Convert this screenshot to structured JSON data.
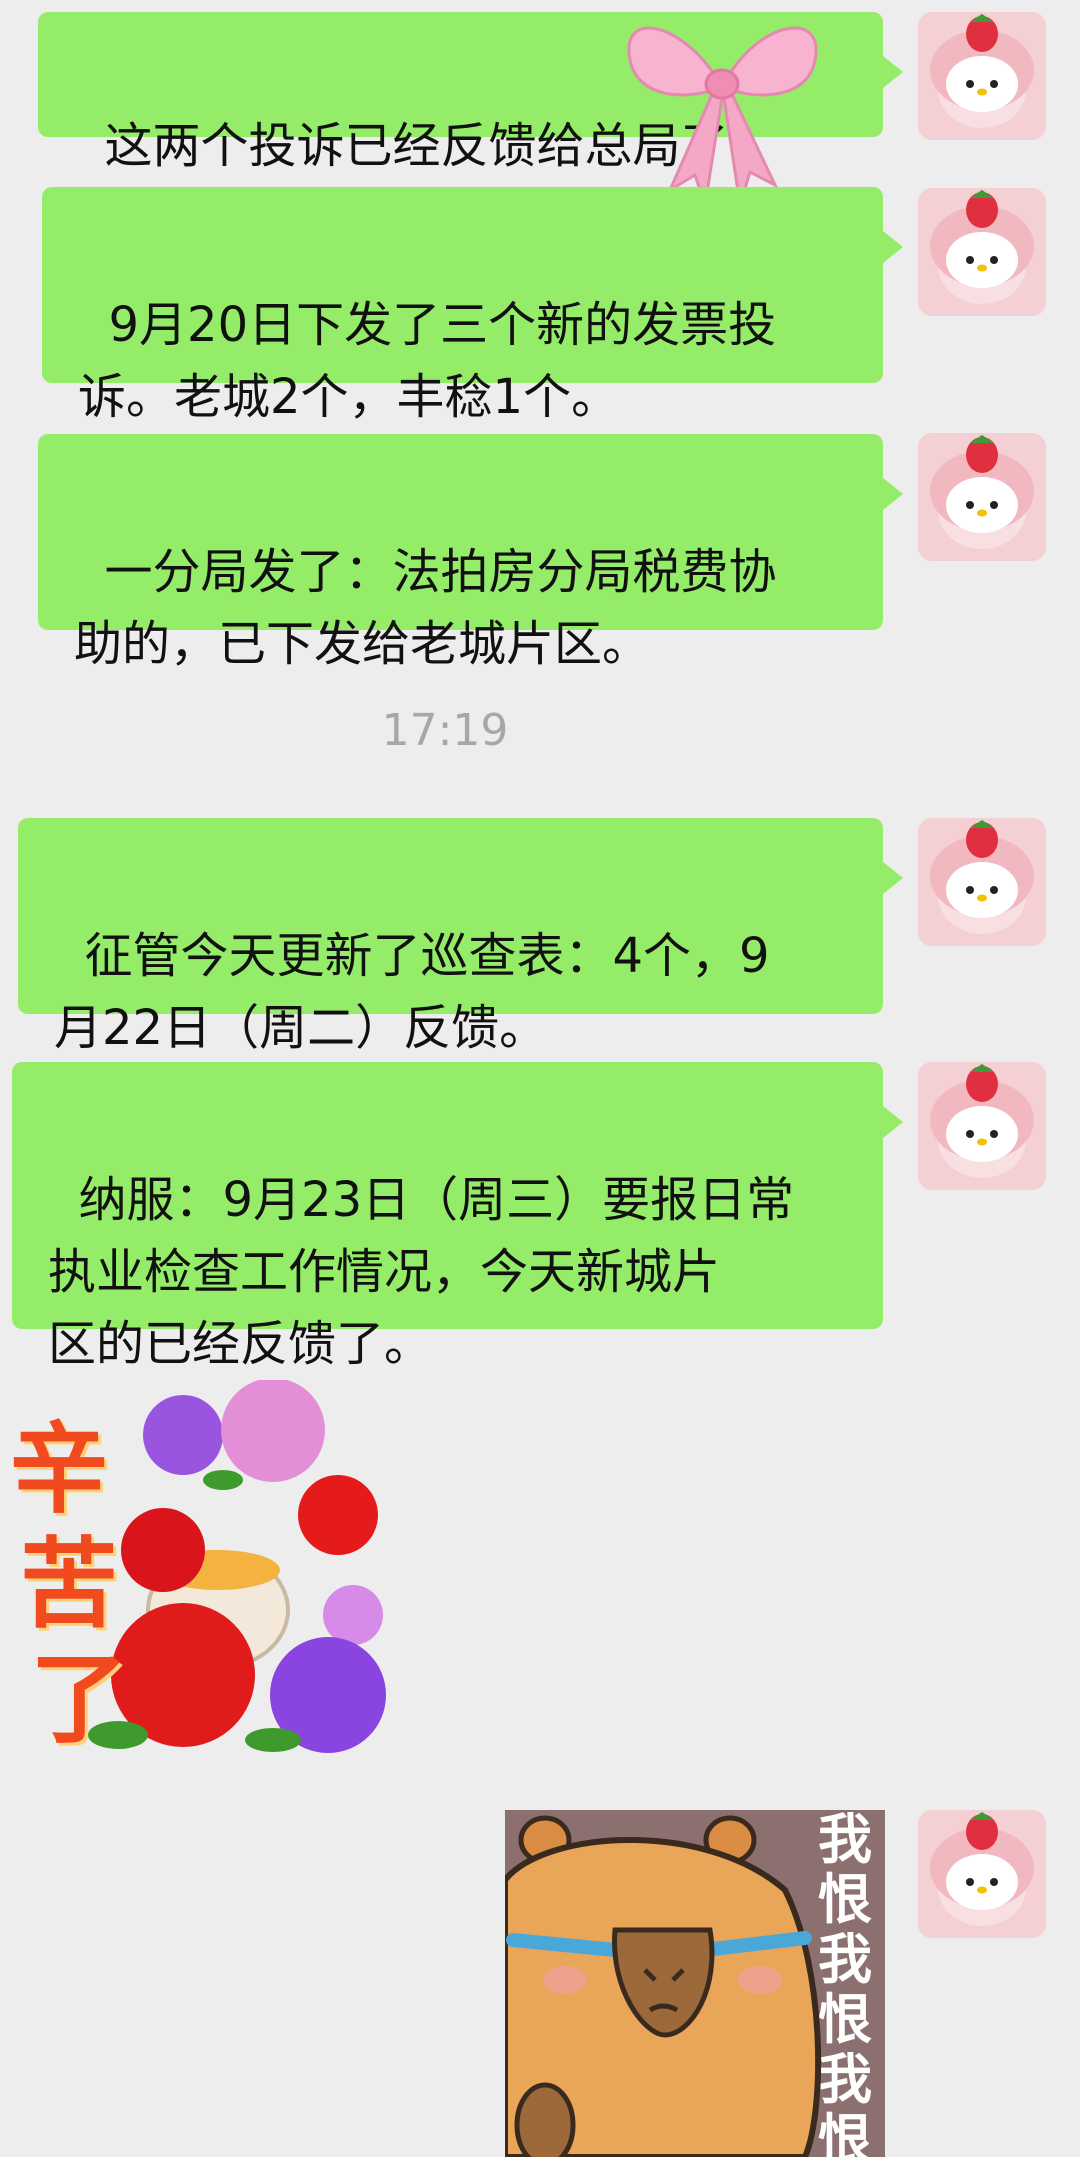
{
  "messages": [
    {
      "text": "这两个投诉已经反馈给总局了"
    },
    {
      "text": "9月20日下发了三个新的发票投\n诉。老城2个，丰稔1个。"
    },
    {
      "text": "一分局发了：法拍房分局税费协\n助的，已下发给老城片区。"
    },
    {
      "text": "征管今天更新了巡查表：4个，9\n月22日（周二）反馈。"
    },
    {
      "text": "纳服：9月23日（周三）要报日常\n执业检查工作情况，今天新城片\n区的已经反馈了。"
    }
  ],
  "timestamp": "17:19",
  "stickers": {
    "roses": {
      "text_lines": [
        "辛",
        "苦",
        "了"
      ]
    },
    "capybara": {
      "text_lines": [
        "我",
        "恨",
        "我",
        "恨",
        "我",
        "恨"
      ]
    }
  },
  "colors": {
    "background": "#ededed",
    "bubble": "#95ec69",
    "timestamp": "#a7a7a7"
  },
  "icons": [
    "hello-kitty-avatar-icon",
    "pink-bow-icon",
    "rose-teacup-sticker",
    "crying-capybara-sticker"
  ]
}
